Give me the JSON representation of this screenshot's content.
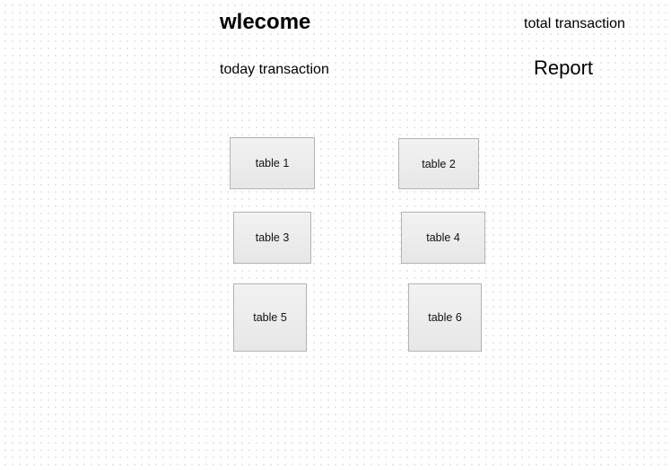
{
  "header": {
    "welcome": "wlecome",
    "total_transaction": "total transaction",
    "today_transaction": "today transaction",
    "report": "Report"
  },
  "tables": [
    {
      "label": "table 1"
    },
    {
      "label": "table 2"
    },
    {
      "label": "table 3"
    },
    {
      "label": "table 4"
    },
    {
      "label": "table 5"
    },
    {
      "label": "table 6"
    }
  ]
}
